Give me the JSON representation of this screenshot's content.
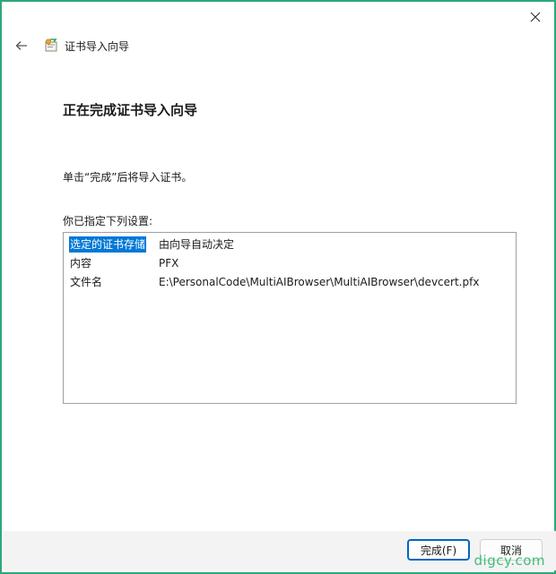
{
  "window": {
    "close_glyph": "✕",
    "back_glyph": "←",
    "wizard_name": "证书导入向导",
    "icons": [
      "close-icon",
      "back-arrow-icon",
      "certificate-icon"
    ]
  },
  "main": {
    "heading": "正在完成证书导入向导",
    "instruction": "单击“完成”后将导入证书。",
    "settings_label": "你已指定下列设置:",
    "settings": [
      {
        "key": "选定的证书存储",
        "value": "由向导自动决定",
        "selected": true
      },
      {
        "key": "内容",
        "value": "PFX",
        "selected": false
      },
      {
        "key": "文件名",
        "value": "E:\\PersonalCode\\MultiAIBrowser\\MultiAIBrowser\\devcert.pfx",
        "selected": false
      }
    ]
  },
  "footer": {
    "finish_label": "完成(F)",
    "cancel_label": "取消"
  },
  "watermark": "digcy.com",
  "colors": {
    "border": "#2fa77a",
    "selection": "#0078d7",
    "primary_button_border": "#0067c0",
    "watermark": "#3bbf7a"
  }
}
